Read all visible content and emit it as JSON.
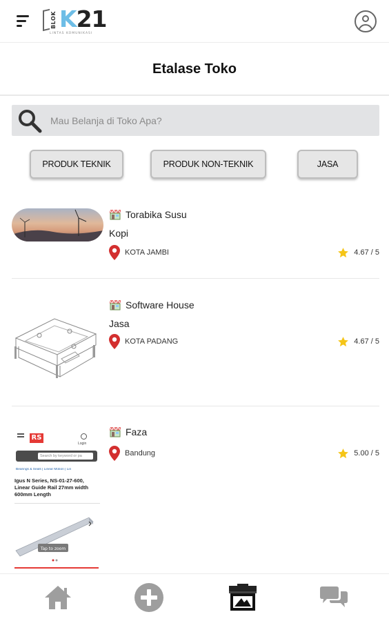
{
  "header": {
    "logo": {
      "brand_prefix": "K",
      "brand_suffix": "21",
      "side_text": "BLOK",
      "tagline": "LINTAS KOMUNIKASI"
    }
  },
  "page": {
    "title": "Etalase Toko"
  },
  "search": {
    "placeholder": "Mau Belanja di Toko Apa?",
    "value": ""
  },
  "categories": [
    {
      "label": "PRODUK TEKNIK"
    },
    {
      "label": "PRODUK NON-TEKNIK"
    },
    {
      "label": "JASA"
    }
  ],
  "stores": [
    {
      "name": "Torabika Susu",
      "category": "Kopi",
      "location": "KOTA JAMBI",
      "rating": "4.67 / 5"
    },
    {
      "name": "Software House",
      "category": "Jasa",
      "location": "KOTA PADANG",
      "rating": "4.67 / 5"
    },
    {
      "name": "Faza",
      "category": "",
      "location": "Bandung",
      "rating": "5.00 / 5",
      "thumbnail": {
        "search_placeholder": "Search by keyword or pa",
        "nav_links": [
          "Bearings & Seals",
          "Linear Motion",
          "Lin"
        ],
        "product_title": "Igus N Series, NS-01-27-600, Linear Guide Rail 27mm width 600mm Length",
        "zoom_hint": "Tap to zoom",
        "header_labels": [
          "Login"
        ]
      }
    }
  ],
  "bottom_nav": [
    {
      "icon": "home-icon"
    },
    {
      "icon": "add-circle-icon"
    },
    {
      "icon": "store-icon"
    },
    {
      "icon": "chat-icon"
    }
  ],
  "colors": {
    "accent_blue": "#6dbde6",
    "pin_red": "#d32f2f",
    "star_yellow": "#f5c518",
    "nav_icon_grey": "#9e9e9e",
    "search_bg": "#e2e3e5"
  }
}
